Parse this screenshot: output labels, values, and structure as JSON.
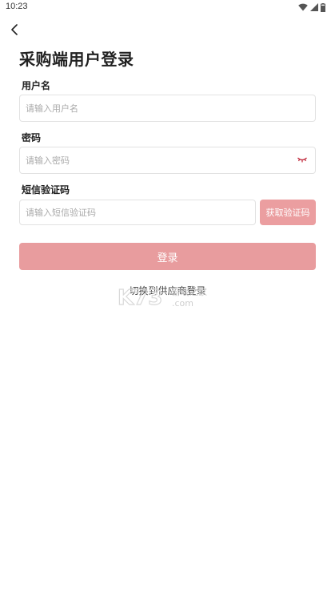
{
  "status_bar": {
    "time": "10:23",
    "icons": [
      "wifi-icon",
      "signal-icon",
      "battery-icon"
    ]
  },
  "header": {
    "back_icon": "chevron-left-icon",
    "title": "采购端用户登录"
  },
  "form": {
    "username": {
      "label": "用户名",
      "placeholder": "请输入用户名",
      "value": ""
    },
    "password": {
      "label": "密码",
      "placeholder": "请输入密码",
      "value": "",
      "toggle_icon": "eye-closed-icon"
    },
    "sms_code": {
      "label": "短信验证码",
      "placeholder": "请输入短信验证码",
      "value": "",
      "button_label": "获取验证码"
    }
  },
  "login_button": {
    "label": "登录"
  },
  "switch_link": {
    "label": "切换到供应商登录"
  },
  "watermark": {
    "text": "K73",
    "sub": "游戏之家",
    "domain": ".com"
  },
  "colors": {
    "accent": "#e89c9e",
    "sms_button": "#eb9ea0",
    "eye_icon": "#c0283a",
    "input_border": "#e2e2e2"
  }
}
